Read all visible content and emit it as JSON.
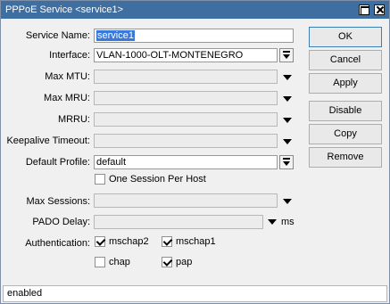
{
  "window": {
    "title": "PPPoE Service <service1>"
  },
  "form": {
    "service_name": {
      "label": "Service Name:",
      "value": "service1"
    },
    "interface": {
      "label": "Interface:",
      "value": "VLAN-1000-OLT-MONTENEGRO"
    },
    "max_mtu": {
      "label": "Max MTU:",
      "value": ""
    },
    "max_mru": {
      "label": "Max MRU:",
      "value": ""
    },
    "mrru": {
      "label": "MRRU:",
      "value": ""
    },
    "keepalive_timeout": {
      "label": "Keepalive Timeout:",
      "value": ""
    },
    "default_profile": {
      "label": "Default Profile:",
      "value": "default"
    },
    "one_session_per_host": {
      "label": "One Session Per Host",
      "checked": false
    },
    "max_sessions": {
      "label": "Max Sessions:",
      "value": ""
    },
    "pado_delay": {
      "label": "PADO Delay:",
      "value": "",
      "unit": "ms"
    },
    "authentication": {
      "label": "Authentication:",
      "options": [
        {
          "label": "mschap2",
          "checked": true
        },
        {
          "label": "mschap1",
          "checked": true
        },
        {
          "label": "chap",
          "checked": false
        },
        {
          "label": "pap",
          "checked": true
        }
      ]
    }
  },
  "buttons": {
    "ok": "OK",
    "cancel": "Cancel",
    "apply": "Apply",
    "disable": "Disable",
    "copy": "Copy",
    "remove": "Remove"
  },
  "status": "enabled",
  "icons": {
    "maximize": "maximize-icon",
    "close": "close-icon",
    "dropdown": "dropdown-arrow-icon"
  },
  "colors": {
    "titlebar": "#3f6ea1",
    "selection": "#3879d9",
    "window_bg": "#f0f0f0"
  }
}
